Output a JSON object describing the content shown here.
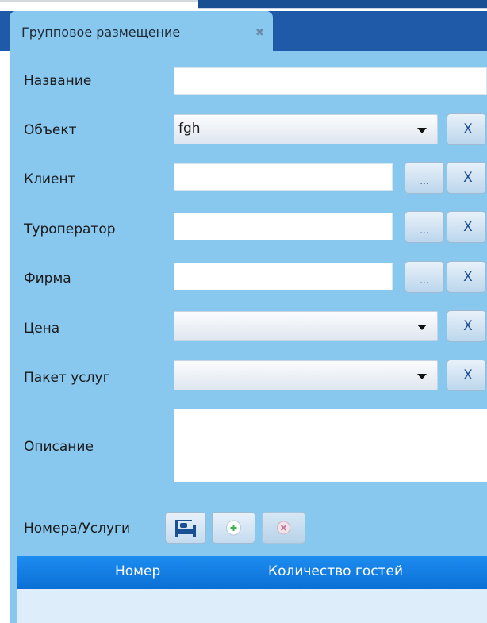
{
  "tab": {
    "title": "Групповое размещение",
    "close_glyph": "✖"
  },
  "form": {
    "name_label": "Название",
    "name_value": "",
    "object_label": "Объект",
    "object_value": "fgh",
    "client_label": "Клиент",
    "client_value": "",
    "touroperator_label": "Туроператор",
    "touroperator_value": "",
    "firm_label": "Фирма",
    "firm_value": "",
    "price_label": "Цена",
    "price_value": "",
    "package_label": "Пакет услуг",
    "package_value": "",
    "description_label": "Описание",
    "description_value": ""
  },
  "buttons": {
    "clear": "X",
    "browse": "..."
  },
  "rooms": {
    "label": "Номера/Услуги"
  },
  "grid": {
    "columns": [
      "Номер",
      "Количество гостей"
    ]
  },
  "colors": {
    "tabbar": "#1f5aa8",
    "panel": "#88c7ee",
    "grid_header": "#1480e6",
    "grid_body": "#ddeefa"
  },
  "icons": [
    "bed-icon",
    "add-circle-icon",
    "remove-circle-icon",
    "dropdown-arrow-icon",
    "tab-close-icon"
  ]
}
